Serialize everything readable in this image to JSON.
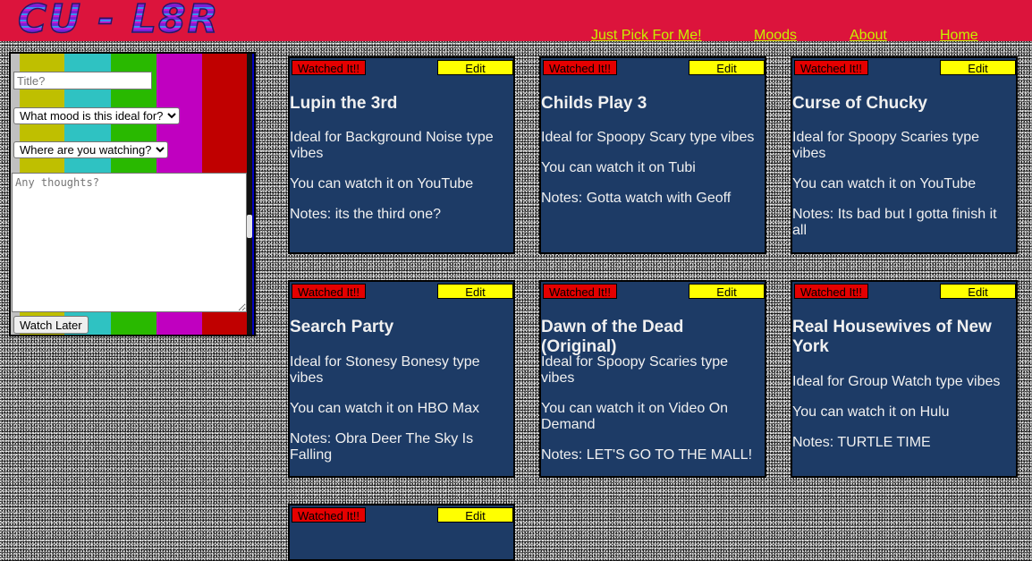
{
  "header": {
    "logo": "CU - L8R",
    "nav": {
      "pick": "Just Pick For Me!",
      "moods": "Moods",
      "about": "About",
      "home": "Home"
    }
  },
  "form": {
    "title_placeholder": "Title?",
    "mood_selected": "What mood is this ideal for?",
    "where_selected": "Where are you watching?",
    "notes_placeholder": "Any thoughts?",
    "submit_label": "Watch Later"
  },
  "card_buttons": {
    "watched_label": "Watched It!!",
    "edit_label": "Edit"
  },
  "cards": [
    {
      "title": "Lupin the 3rd",
      "mood": "Ideal for Background Noise type vibes",
      "where": "You can watch it on YouTube",
      "notes": "Notes: its the third one?"
    },
    {
      "title": "Childs Play 3",
      "mood": "Ideal for Spoopy Scary type vibes",
      "where": "You can watch it on Tubi",
      "notes": "Notes: Gotta watch with Geoff"
    },
    {
      "title": "Curse of Chucky",
      "mood": "Ideal for Spoopy Scaries type vibes",
      "where": "You can watch it on YouTube",
      "notes": "Notes: Its bad but I gotta finish it all"
    },
    {
      "title": "Search Party",
      "mood": "Ideal for Stonesy Bonesy type vibes",
      "where": "You can watch it on HBO Max",
      "notes": "Notes: Obra Deer The Sky Is Falling"
    },
    {
      "title": "Dawn of the Dead (Original)",
      "mood": "Ideal for Spoopy Scaries type vibes",
      "where": "You can watch it on Video On Demand",
      "notes": "Notes: LET'S GO TO THE MALL!"
    },
    {
      "title": "Real Housewives of New York",
      "mood": "Ideal for Group Watch type vibes",
      "where": "You can watch it on Hulu",
      "notes": "Notes: TURTLE TIME"
    }
  ]
}
